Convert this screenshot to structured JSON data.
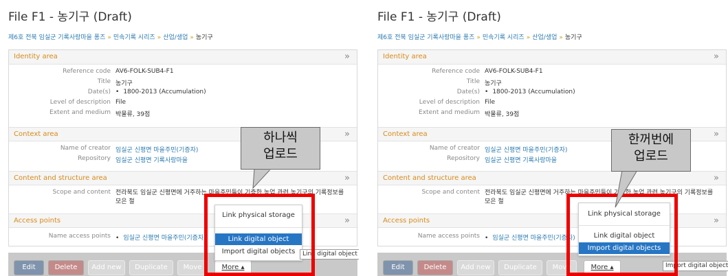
{
  "page_title": "File F1 - 농기구 (Draft)",
  "breadcrumb": [
    "제6호 전북 임실군 기록사랑마을 퐁즈",
    "민속기록 시리즈",
    "산업/생업",
    "농기구"
  ],
  "chevron": "»",
  "sections": {
    "identity": {
      "title": "Identity area",
      "rows": [
        {
          "label": "Reference code",
          "value": "AV6-FOLK-SUB4-F1"
        },
        {
          "label": "Title",
          "value": "농기구"
        },
        {
          "label": "Date(s)",
          "value": "1800-2013 (Accumulation)"
        },
        {
          "label": "Level of description",
          "value": "File"
        },
        {
          "label": "Extent and medium",
          "value": "박물류, 39점"
        }
      ]
    },
    "context": {
      "title": "Context area",
      "rows": [
        {
          "label": "Name of creator",
          "value": "임실군 신평면 마을주민(기증자)"
        },
        {
          "label": "Repository",
          "value": "임실군 신평면 기록사랑마을"
        }
      ]
    },
    "content": {
      "title": "Content and structure area",
      "rows": [
        {
          "label": "Scope and content",
          "value": "전라북도 임실군 신평면에 거주하는 마을주민들이 기증한 농업 관련 농기구의 기록정보를 모은 철"
        }
      ]
    },
    "access": {
      "title": "Access points",
      "rows": [
        {
          "label": "Name access points",
          "value": "임실군 신평면 마을주민(기증자)"
        }
      ]
    }
  },
  "actions": {
    "edit": "Edit",
    "delete": "Delete",
    "add_new": "Add new",
    "duplicate": "Duplicate",
    "move": "Move",
    "more": "More ▴"
  },
  "dropdown": {
    "link_physical_storage": "Link physical storage",
    "link_digital_object": "Link digital object",
    "import_digital_objects": "Import digital objects"
  },
  "left": {
    "callout": [
      "하나씩",
      "업로드"
    ],
    "tooltip": "Link digital object"
  },
  "right": {
    "callout": [
      "한꺼번에",
      "업로드"
    ],
    "tooltip": "Import digital objects"
  },
  "colors": {
    "section_title": "#d88a1a",
    "link": "#2a7ab0",
    "highlight": "#2776c4",
    "annotation_box": "#ee0000"
  }
}
